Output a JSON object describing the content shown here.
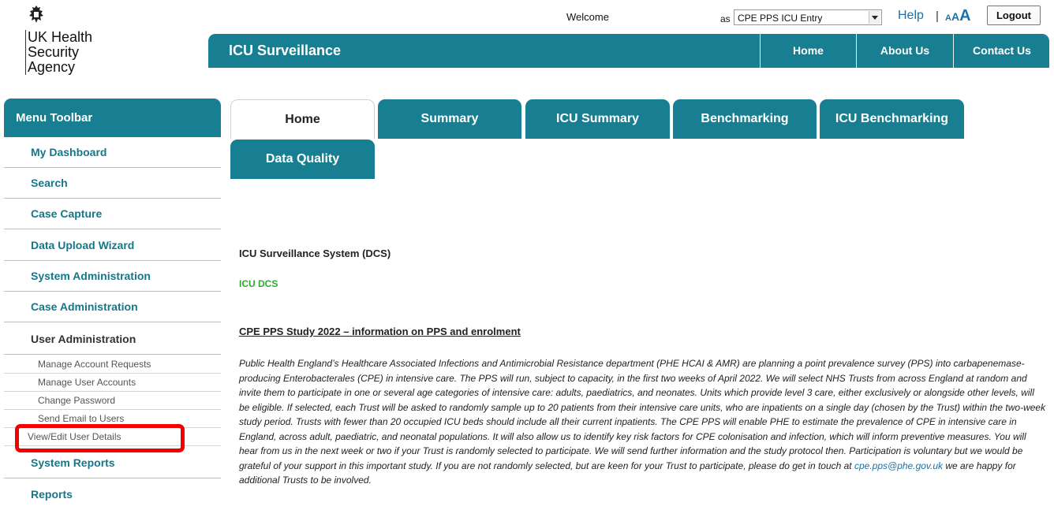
{
  "logo": {
    "lines": [
      "UK Health",
      "Security",
      "Agency"
    ],
    "icon": "royal-crest-icon"
  },
  "topbar": {
    "welcome": "Welcome",
    "as_label": "as",
    "role_value": "CPE PPS ICU Entry",
    "help": "Help",
    "separator": "|",
    "text_size": [
      "A",
      "A",
      "A"
    ],
    "logout": "Logout"
  },
  "header": {
    "title": "ICU Surveillance",
    "nav": [
      "Home",
      "About Us",
      "Contact Us"
    ],
    "color": "#187f92"
  },
  "sidebar": {
    "title": "Menu Toolbar",
    "items": [
      "My Dashboard",
      "Search",
      "Case Capture",
      "Data Upload Wizard",
      "System Administration",
      "Case Administration",
      "User Administration"
    ],
    "sub_items": [
      "Manage Account Requests",
      "Manage User Accounts",
      "Change Password",
      "Send Email to Users",
      "View/Edit User Details"
    ],
    "after_items": [
      "System Reports",
      "Reports"
    ]
  },
  "tabs": [
    "Home",
    "Summary",
    "ICU Summary",
    "Benchmarking",
    "ICU Benchmarking",
    "Data Quality"
  ],
  "content": {
    "heading": "ICU Surveillance System (DCS)",
    "dcs_label": "ICU DCS",
    "study_title": "CPE PPS Study 2022 – information on PPS and enrolment",
    "body": "Public Health England’s Healthcare Associated Infections and Antimicrobial Resistance department (PHE HCAI & AMR) are planning a point prevalence survey (PPS) into carbapenemase-producing Enterobacterales (CPE) in intensive care. The PPS will run, subject to capacity, in the first two weeks of April 2022. We will select NHS Trusts from across England at random and invite them to participate in one or several age categories of intensive care: adults, paediatrics, and neonates. Units which provide level 3 care, either exclusively or alongside other levels, will be eligible. If selected, each Trust will be asked to randomly sample up to 20 patients from their intensive care units, who are inpatients on a single day (chosen by the Trust) within the two-week study period. Trusts with fewer than 20 occupied ICU beds should include all their current inpatients. The CPE PPS will enable PHE to estimate the prevalence of CPE in intensive care in England, across adult, paediatric, and neonatal populations. It will also allow us to identify key risk factors for CPE colonisation and infection, which will inform preventive measures. You will hear from us in the next week or two if your Trust is randomly selected to participate. We will send further information and the study protocol then. Participation is voluntary but we would be grateful of your support in this important study. If you are not randomly selected, but are keen for your Trust to participate, please do get in touch at",
    "email": "cpe.pps@phe.gov.uk",
    "body_end": " we are happy for additional Trusts to be involved."
  },
  "colors": {
    "teal": "#187f92",
    "link": "#1a73a8",
    "green": "#2eaa2e",
    "highlight": "#f20000"
  }
}
